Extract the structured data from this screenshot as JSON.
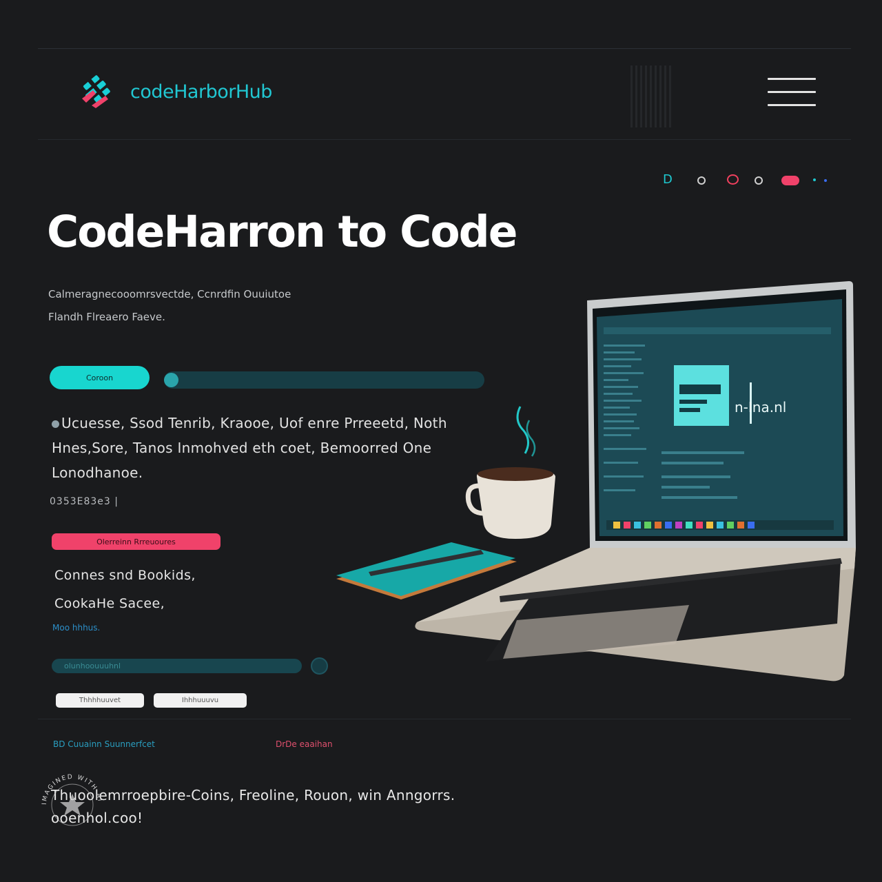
{
  "header": {
    "logo_text": "codeHarborHub",
    "menu_icon": "hamburger-menu-icon"
  },
  "indicators": {
    "first_glyph": "D",
    "items": [
      "dot",
      "dot-red",
      "dot",
      "pill",
      "dots"
    ]
  },
  "hero": {
    "title": "CodeHarron to Code",
    "subtitle_line1": "Calmeragnecooomrsvectde, Ccnrdfin Ouuiutoe",
    "subtitle_line2": "Flandh Flreaero Faeve.",
    "primary_button": "Coroon",
    "paragraph": "Ucuesse, Ssod Tenrib, Kraooe, Uof enre Prreeetd, Noth Hnes,Sore, Tanos Inmohved eth coet, Bemoorred One Lonodhanoe.",
    "small_code": "0353E83e3 |",
    "secondary_button": "Olerreinn Rrreuoures",
    "list_line1": "Connes snd Bookids,",
    "list_line2": "CookaHe Sacee,",
    "mini_link": "Moo hhhus.",
    "progress_label": "olunhoouuuhnl",
    "button_left": "Thhhhuuvet",
    "button_right": "Ihhhuuuvu"
  },
  "footer": {
    "link_left": "BD Cuuainn Suunnerfcet",
    "link_right": "DrDe eaaihan",
    "text_line1": "Thuoolemrroepbire-Coins, Freoline, Rouon, win Anngorrs.",
    "text_line2": "ooenhol.coo!",
    "badge_text": "IMAGINED WITH AI"
  },
  "illustration": {
    "screen_text": "n-Ina.nl"
  },
  "colors": {
    "background": "#1a1b1d",
    "teal": "#18d6cf",
    "pink": "#f0426a",
    "logo": "#21c7d2"
  }
}
